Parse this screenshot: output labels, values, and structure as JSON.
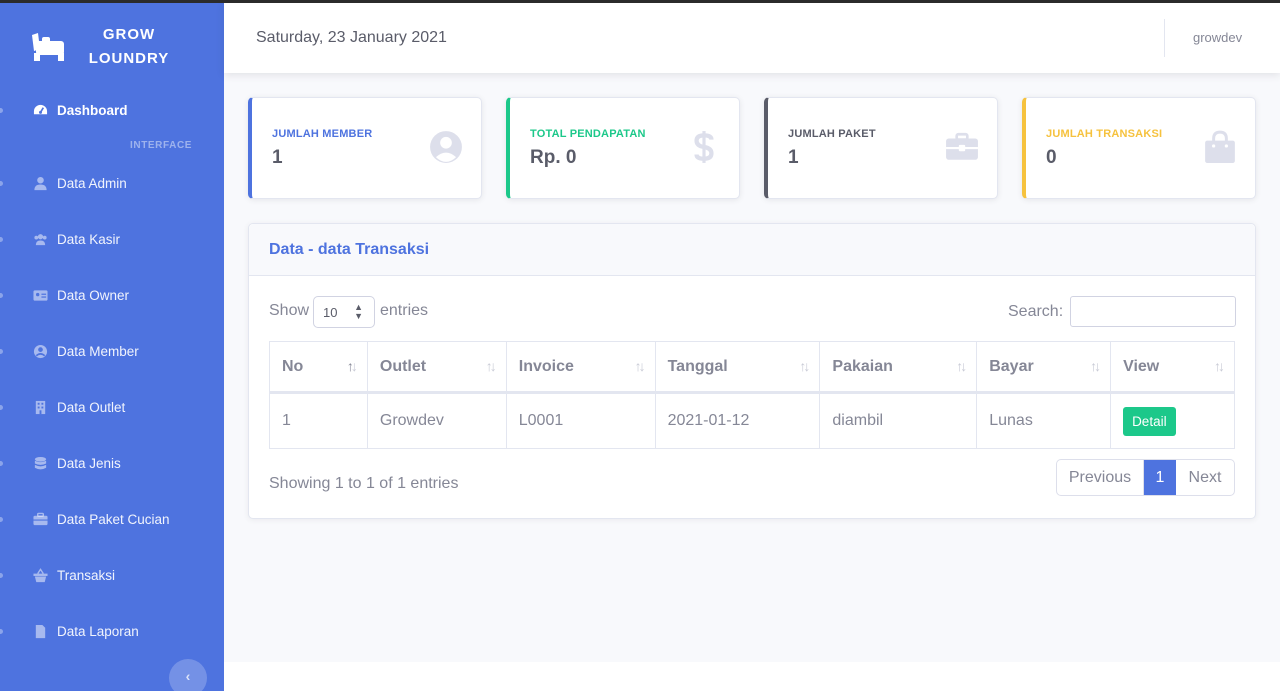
{
  "brand": {
    "name": "GROW LOUNDRY",
    "icon": "bed-icon"
  },
  "sidebar": {
    "heading": "INTERFACE",
    "items": [
      {
        "label": "Dashboard",
        "icon": "tachometer-icon",
        "active": true
      },
      {
        "label": "Data Admin",
        "icon": "user-icon"
      },
      {
        "label": "Data Kasir",
        "icon": "users-icon"
      },
      {
        "label": "Data Owner",
        "icon": "id-card-icon"
      },
      {
        "label": "Data Member",
        "icon": "user-circle-icon"
      },
      {
        "label": "Data Outlet",
        "icon": "building-icon"
      },
      {
        "label": "Data Jenis",
        "icon": "database-icon"
      },
      {
        "label": "Data Paket Cucian",
        "icon": "briefcase-icon"
      },
      {
        "label": "Transaksi",
        "icon": "basket-icon"
      },
      {
        "label": "Data Laporan",
        "icon": "file-icon"
      }
    ],
    "toggle": "‹"
  },
  "topbar": {
    "date": "Saturday, 23 January 2021",
    "user": "growdev"
  },
  "cards": [
    {
      "title": "JUMLAH MEMBER",
      "value": "1",
      "color": "#4e73df",
      "icon": "user-circle-icon"
    },
    {
      "title": "TOTAL PENDAPATAN",
      "value": "Rp. 0",
      "color": "#1cc88a",
      "icon": "dollar-icon"
    },
    {
      "title": "JUMLAH PAKET",
      "value": "1",
      "color": "#5a5c69",
      "icon": "toolbox-icon"
    },
    {
      "title": "JUMLAH TRANSAKSI",
      "value": "0",
      "color": "#f6c23e",
      "icon": "shopping-bag-icon"
    }
  ],
  "panel": {
    "title": "Data - data Transaksi",
    "show_label": "Show",
    "page_length": "10",
    "entries_label": "entries",
    "search_label": "Search:",
    "search_value": "",
    "columns": [
      "No",
      "Outlet",
      "Invoice",
      "Tanggal",
      "Pakaian",
      "Bayar",
      "View"
    ],
    "rows": [
      {
        "no": "1",
        "outlet": "Growdev",
        "invoice": "L0001",
        "tanggal": "2021-01-12",
        "pakaian": "diambil",
        "bayar": "Lunas",
        "action": "Detail"
      }
    ],
    "info": "Showing 1 to 1 of 1 entries",
    "pagination": {
      "previous": "Previous",
      "current": "1",
      "next": "Next"
    }
  }
}
